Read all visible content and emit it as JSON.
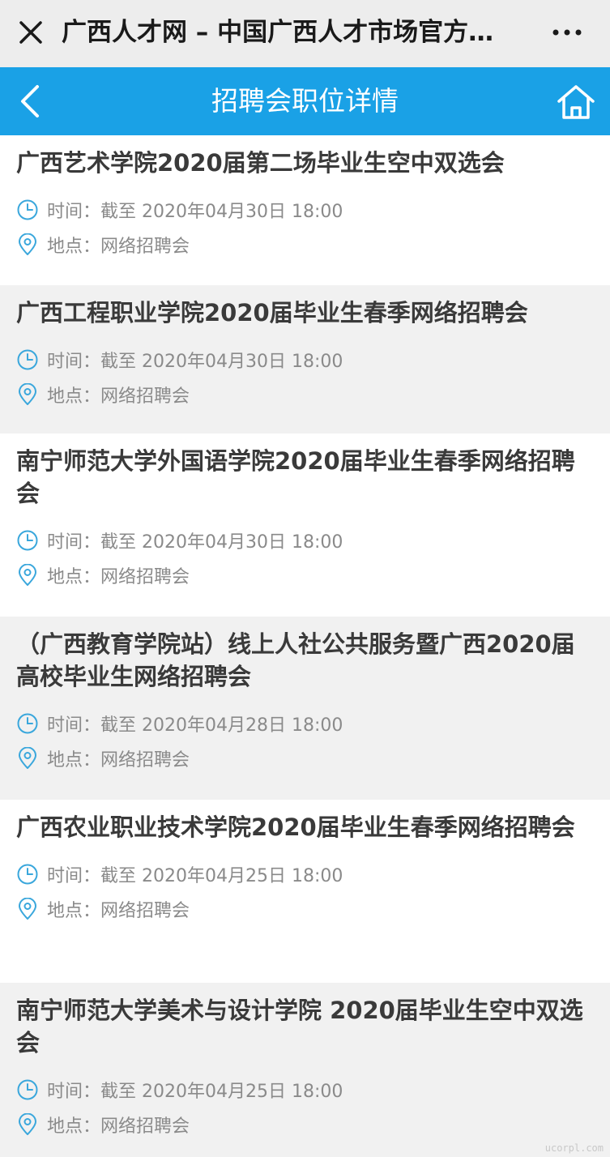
{
  "wechat_bar": {
    "title": "广西人才网 – 中国广西人才市场官方…",
    "close_icon": "close-icon",
    "more_icon": "more-dots-icon"
  },
  "app_bar": {
    "title": "招聘会职位详情",
    "back_icon": "chevron-left-icon",
    "home_icon": "home-icon",
    "color": "#1aa1e6"
  },
  "labels": {
    "time": "时间：",
    "place": "地点："
  },
  "fairs": [
    {
      "title": "广西艺术学院2020届第二场毕业生空中双选会",
      "time": "截至 2020年04月30日 18:00",
      "place": "网络招聘会"
    },
    {
      "title": "广西工程职业学院2020届毕业生春季网络招聘会",
      "time": "截至 2020年04月30日 18:00",
      "place": "网络招聘会"
    },
    {
      "title": "南宁师范大学外国语学院2020届毕业生春季网络招聘会",
      "time": "截至 2020年04月30日 18:00",
      "place": "网络招聘会"
    },
    {
      "title": "（广西教育学院站）线上人社公共服务暨广西2020届高校毕业生网络招聘会",
      "time": "截至 2020年04月28日 18:00",
      "place": "网络招聘会"
    },
    {
      "title": "广西农业职业技术学院2020届毕业生春季网络招聘会",
      "time": "截至 2020年04月25日 18:00",
      "place": "网络招聘会"
    },
    {
      "title": "南宁师范大学美术与设计学院 2020届毕业生空中双选会",
      "time": "截至 2020年04月25日 18:00",
      "place": "网络招聘会"
    }
  ],
  "watermark": "ucorpl.com"
}
